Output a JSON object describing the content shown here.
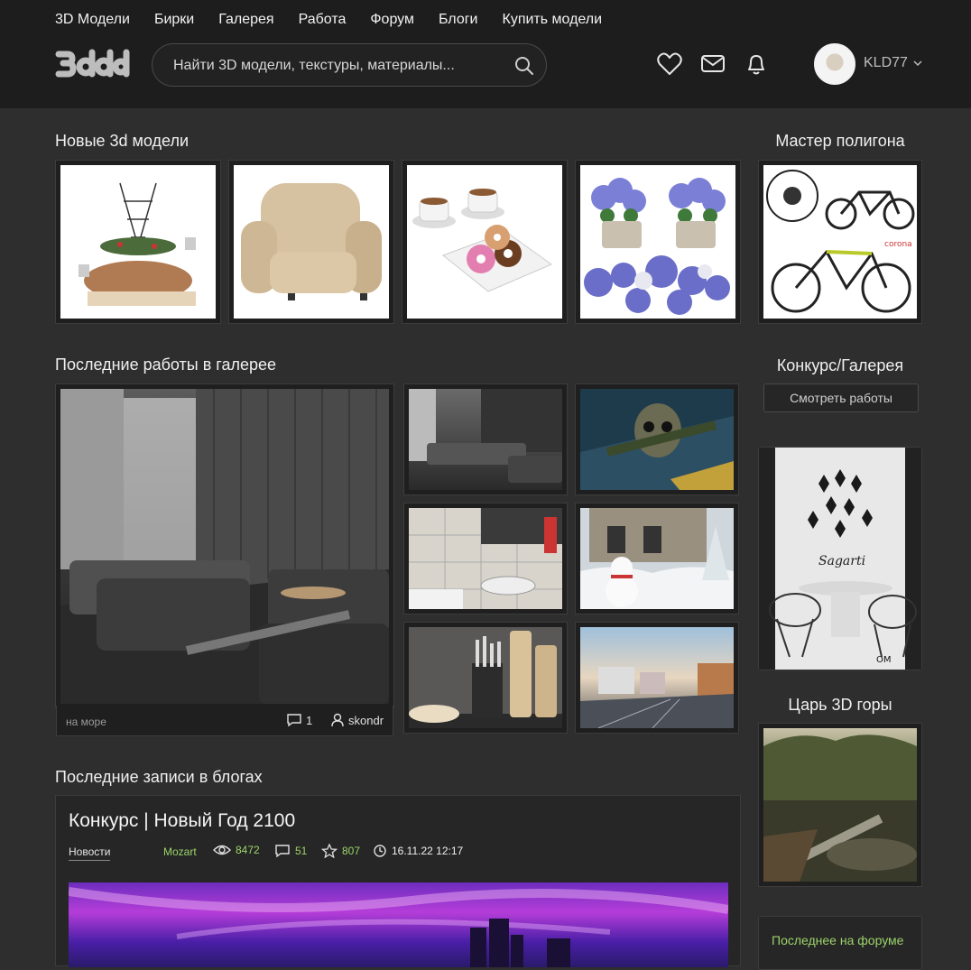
{
  "nav": [
    "3D Модели",
    "Бирки",
    "Галерея",
    "Работа",
    "Форум",
    "Блоги",
    "Купить модели"
  ],
  "search": {
    "placeholder": "Найти 3D модели, текстуры, материалы..."
  },
  "user": {
    "name": "KLD77"
  },
  "sections": {
    "new_models": "Новые 3d модели",
    "gallery": "Последние работы в галерее",
    "blogs": "Последние записи в блогах"
  },
  "sidebar": {
    "master_polygon": "Мастер полигона",
    "contest_gallery": "Конкурс/Галерея",
    "view_works": "Смотреть работы",
    "king_3d": "Царь 3D горы",
    "forum_latest": "Последнее на форуме"
  },
  "gallery_main": {
    "caption": "на море",
    "comments": "1",
    "author": "skondr"
  },
  "blog_post": {
    "title": "Конкурс | Новый Год 2100",
    "category": "Новости",
    "author": "Mozart",
    "views": "8472",
    "comments": "51",
    "rating": "807",
    "date": "16.11.22 12:17"
  },
  "icons": [
    "search-icon",
    "heart-icon",
    "mail-icon",
    "bell-icon",
    "chevron-down-icon",
    "comment-icon",
    "user-icon",
    "eye-icon",
    "star-icon",
    "clock-icon"
  ]
}
